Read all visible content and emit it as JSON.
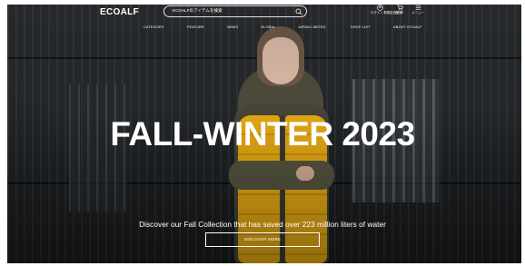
{
  "header": {
    "logo": "ECOALF",
    "search": {
      "placeholder": "ECOALFのアイテムを検索"
    },
    "utilities": [
      {
        "icon": "user-icon",
        "label": "ログイン 新規会員登録"
      },
      {
        "icon": "cart-icon",
        "label": "カート"
      },
      {
        "icon": "menu-icon",
        "label": "メニュー"
      }
    ]
  },
  "nav": {
    "items": [
      {
        "label": "CATEGORY"
      },
      {
        "label": "FEATURE"
      },
      {
        "label": "NEWS"
      },
      {
        "label": "GLOBAL"
      },
      {
        "label": "JAPAN LIMITED"
      },
      {
        "label": "SHOP LIST"
      },
      {
        "label": "ABOUT ECOALF"
      }
    ]
  },
  "hero": {
    "headline": "FALL-WINTER 2023",
    "subtitle": "Discover our Fall Collection that has saved over 223 million liters of water",
    "cta": "DISCOVER MORE",
    "accent_color": "#e2a713"
  }
}
